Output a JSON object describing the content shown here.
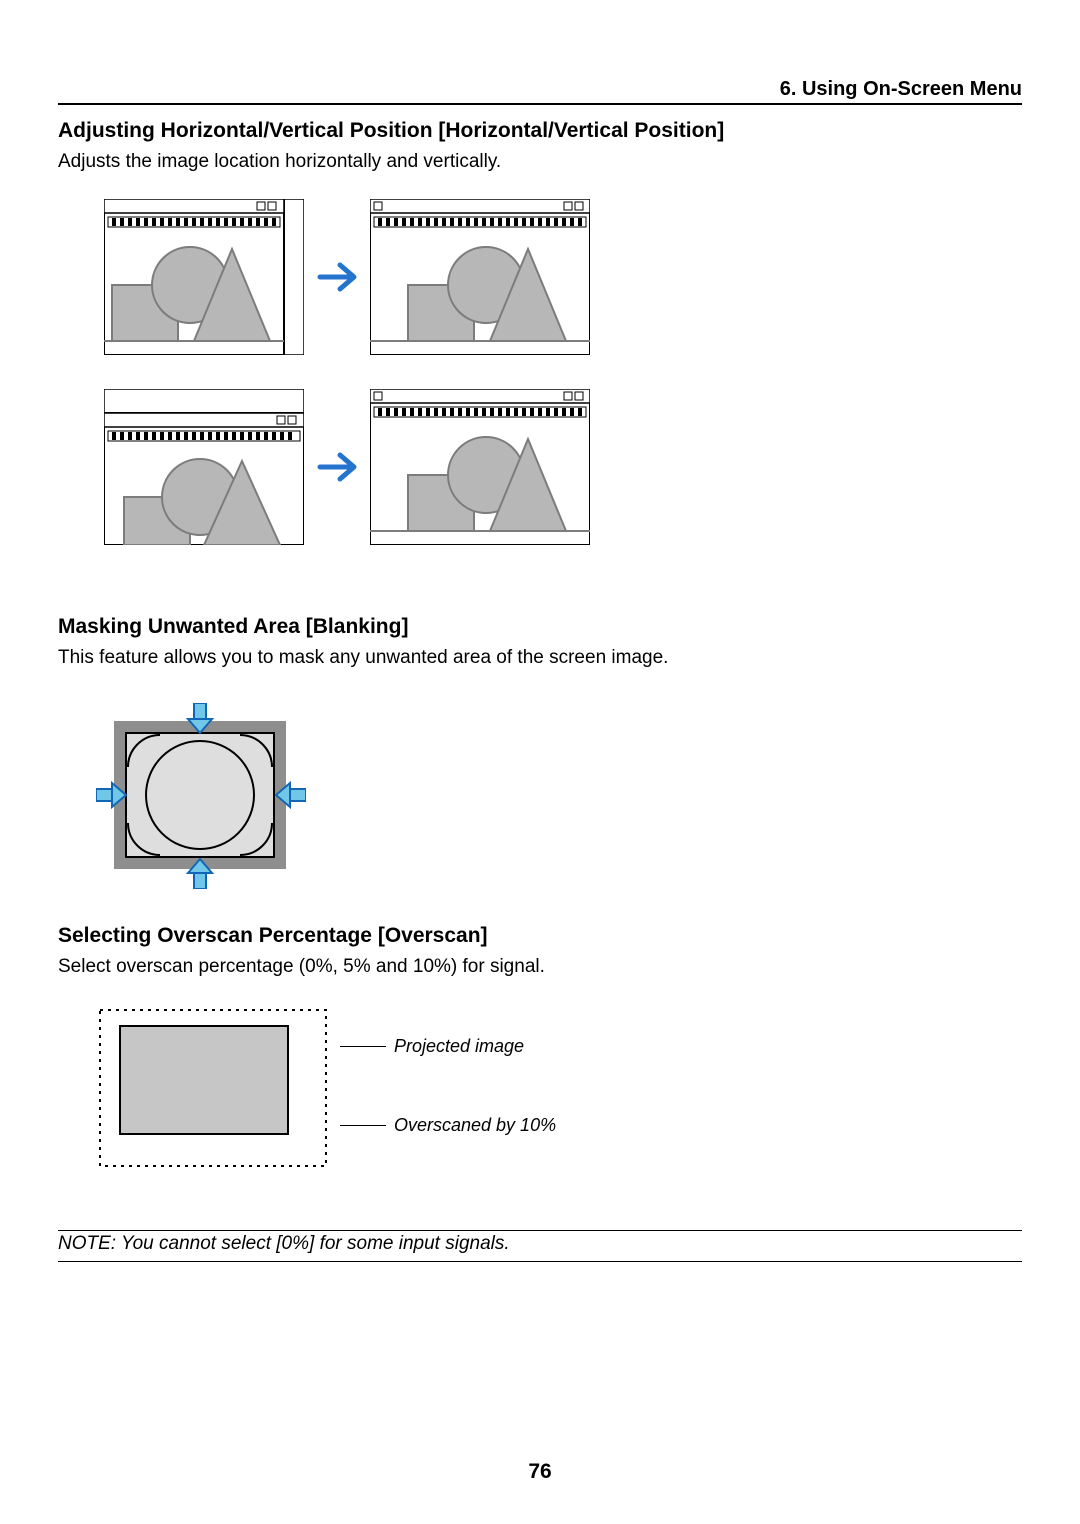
{
  "header": {
    "chapter": "6. Using On-Screen Menu"
  },
  "sections": {
    "position": {
      "heading": "Adjusting Horizontal/Vertical Position [Horizontal/Vertical Position]",
      "body": "Adjusts the image location horizontally and vertically."
    },
    "blanking": {
      "heading": "Masking Unwanted Area [Blanking]",
      "body": "This feature allows you to mask any unwanted area of the screen image."
    },
    "overscan": {
      "heading": "Selecting Overscan Percentage [Overscan]",
      "body": "Select overscan percentage (0%, 5% and 10%) for signal.",
      "label_projected": "Projected image",
      "label_overscanned": "Overscaned by 10%"
    }
  },
  "note": "NOTE: You cannot select [0%] for some input signals.",
  "page_number": "76"
}
